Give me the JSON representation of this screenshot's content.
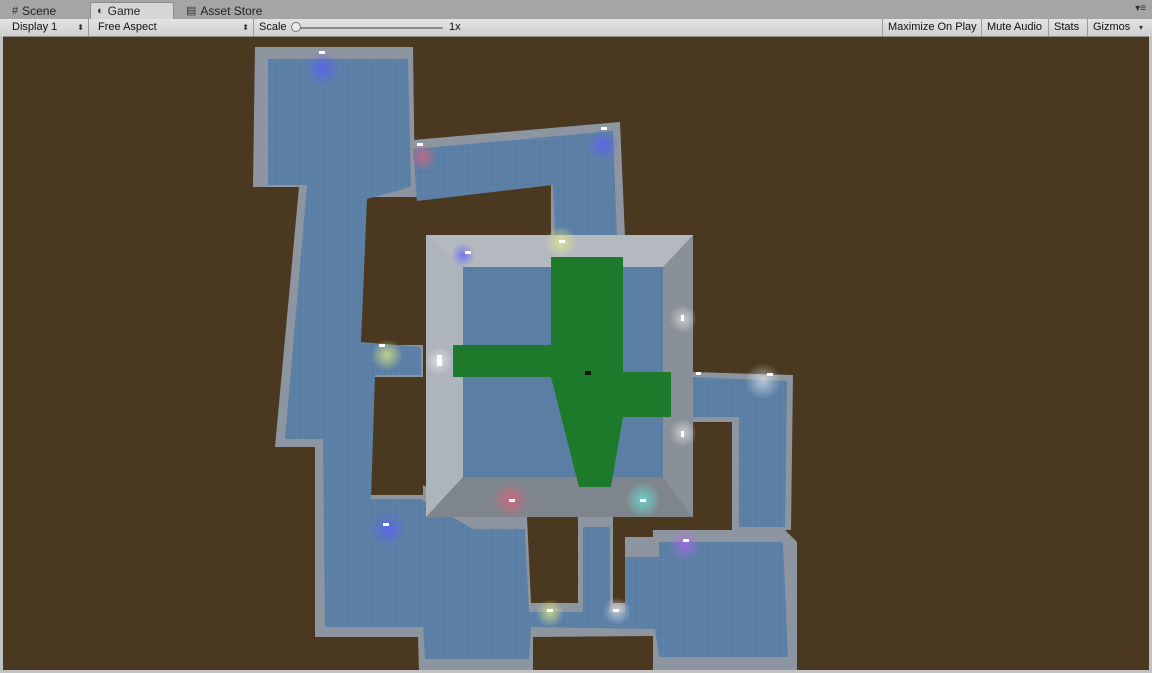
{
  "tabs": [
    {
      "label": "Scene",
      "icon": "grid-icon",
      "active": false
    },
    {
      "label": "Game",
      "icon": "pacman-icon",
      "active": true
    },
    {
      "label": "Asset Store",
      "icon": "store-icon",
      "active": false
    }
  ],
  "toolbar": {
    "display": "Display 1",
    "aspect": "Free Aspect",
    "scale_label": "Scale",
    "scale_value": "1x",
    "scale_level": 0,
    "maximize": "Maximize On Play",
    "mute": "Mute Audio",
    "stats": "Stats",
    "gizmos": "Gizmos"
  },
  "colors": {
    "background": "#4a3820",
    "floor": "#5b7fa4",
    "wall": "#8d96a0",
    "player_area": "#1d7a2a"
  }
}
